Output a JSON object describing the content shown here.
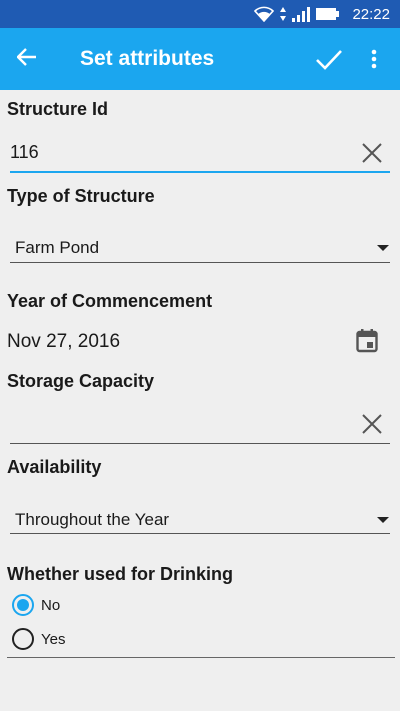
{
  "status_bar": {
    "time": "22:22"
  },
  "app_bar": {
    "title": "Set attributes"
  },
  "form": {
    "structure_id": {
      "label": "Structure Id",
      "value": "116"
    },
    "type_of_structure": {
      "label": "Type of Structure",
      "selected": "Farm Pond"
    },
    "year_of_commencement": {
      "label": "Year of Commencement",
      "value": "Nov 27, 2016"
    },
    "storage_capacity": {
      "label": "Storage Capacity",
      "value": ""
    },
    "availability": {
      "label": "Availability",
      "selected": "Throughout the Year"
    },
    "drinking": {
      "label": "Whether used for Drinking",
      "options": [
        {
          "label": "No",
          "checked": true
        },
        {
          "label": "Yes",
          "checked": false
        }
      ]
    }
  },
  "colors": {
    "status_bar": "#1f5bb3",
    "app_bar": "#1ba6ef",
    "accent": "#1ba6ef",
    "background": "#efefef"
  }
}
